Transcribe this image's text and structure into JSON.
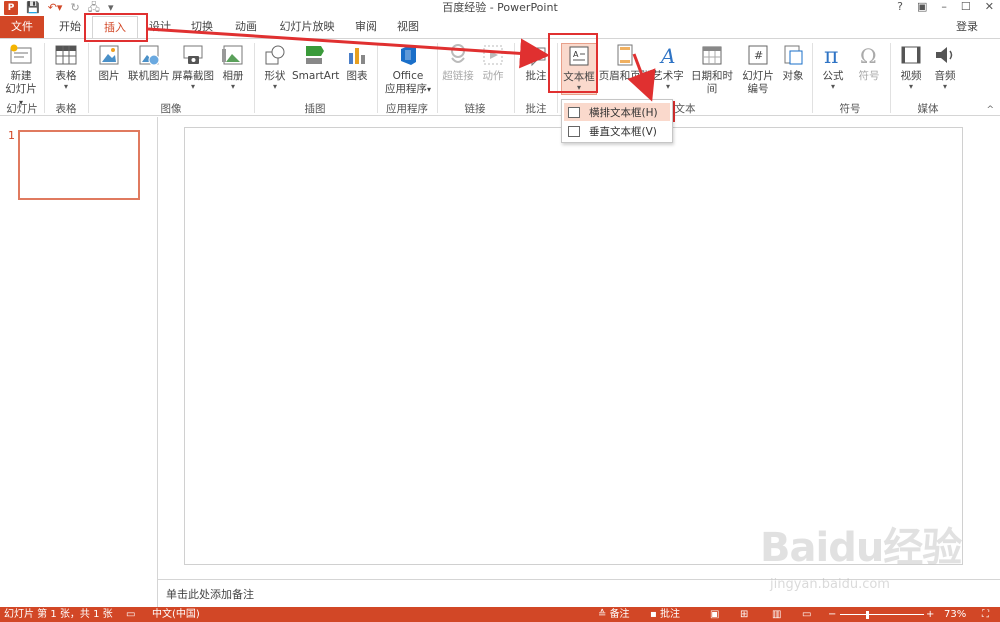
{
  "window": {
    "title": "百度经验 - PowerPoint",
    "help": "?",
    "controls": [
      "–",
      "☐",
      "✕"
    ]
  },
  "qat": {
    "logo": "P",
    "save": "💾",
    "undo": "↶▾",
    "redo": "↻",
    "start_from": "🖧",
    "customize": "▾"
  },
  "tabs": [
    "文件",
    "开始",
    "插入",
    "设计",
    "切换",
    "动画",
    "幻灯片放映",
    "审阅",
    "视图"
  ],
  "active_tab": "插入",
  "signin": "登录",
  "ribbon": {
    "groups": [
      {
        "label": "幻灯片"
      },
      {
        "label": "表格"
      },
      {
        "label": "图像"
      },
      {
        "label": "插图"
      },
      {
        "label": "应用程序"
      },
      {
        "label": "链接"
      },
      {
        "label": "批注"
      },
      {
        "label": "文本"
      },
      {
        "label": "符号"
      },
      {
        "label": "媒体"
      }
    ],
    "buttons": {
      "new_slide": {
        "line1": "新建",
        "line2": "幻灯片"
      },
      "table": "表格",
      "picture": "图片",
      "online_picture": "联机图片",
      "screenshot": "屏幕截图",
      "album": "相册",
      "shapes": "形状",
      "smartart": "SmartArt",
      "chart": "图表",
      "office_apps": {
        "line1": "Office",
        "line2": "应用程序"
      },
      "hyperlink": "超链接",
      "action": "动作",
      "comment": "批注",
      "textbox": "文本框",
      "header_footer": "页眉和页脚",
      "wordart": "艺术字",
      "datetime": "日期和时间",
      "slide_number": {
        "line1": "幻灯片",
        "line2": "编号"
      },
      "object": "对象",
      "equation": "公式",
      "symbol": "符号",
      "video": "视频",
      "audio": "音频"
    }
  },
  "textbox_menu": {
    "items": [
      "横排文本框(H)",
      "垂直文本框(V)"
    ],
    "highlighted": "横排文本框(H)"
  },
  "thumbnails": {
    "slide_number": "1"
  },
  "notes_placeholder": "单击此处添加备注",
  "status": {
    "slide_info": "幻灯片 第 1 张，共 1 张",
    "language": "中文(中国)",
    "notes_btn": "备注",
    "comments_btn": "批注",
    "zoom": "73%"
  },
  "watermark": {
    "brand": "Baidu经验",
    "url": "jingyan.baidu.com"
  },
  "colors": {
    "accent": "#d24726",
    "annotation_red": "#e03030"
  }
}
